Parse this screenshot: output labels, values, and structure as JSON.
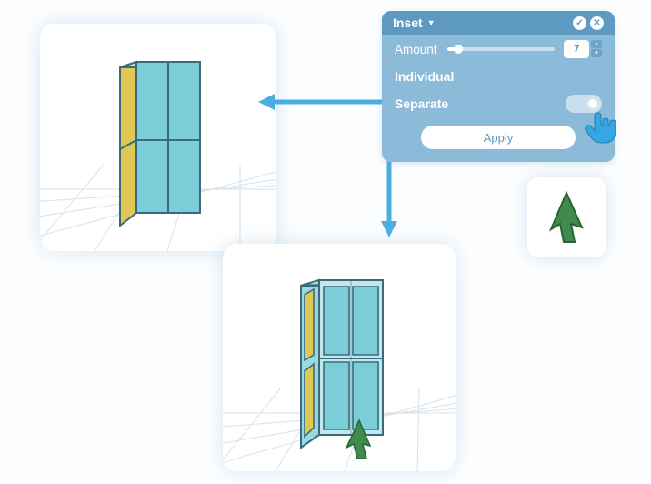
{
  "panel": {
    "title": "Inset",
    "amount_label": "Amount",
    "amount_value": "7",
    "individual_label": "Individual",
    "separate_label": "Separate",
    "separate_on": true,
    "apply_label": "Apply"
  },
  "colors": {
    "panel_bg": "#8bbbd9",
    "panel_header": "#5d99c0",
    "accent": "#4caee0",
    "cube_face": "#7bcdd8",
    "cube_side": "#e0c756",
    "arrow_green": "#3f8a4d"
  }
}
